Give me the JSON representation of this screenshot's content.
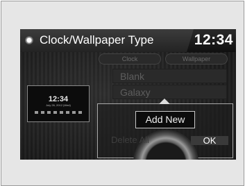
{
  "header": {
    "title": "Clock/Wallpaper Type",
    "time": "12:34"
  },
  "preview": {
    "time": "12:34",
    "date": "July 26, 2012 (Wed)"
  },
  "tabs": [
    {
      "label": "Clock"
    },
    {
      "label": "Wallpaper"
    }
  ],
  "list": [
    {
      "label": "Blank"
    },
    {
      "label": "Galaxy"
    }
  ],
  "popup": {
    "add_new": "Add New",
    "delete_all": "Delete All",
    "ok": "OK"
  }
}
